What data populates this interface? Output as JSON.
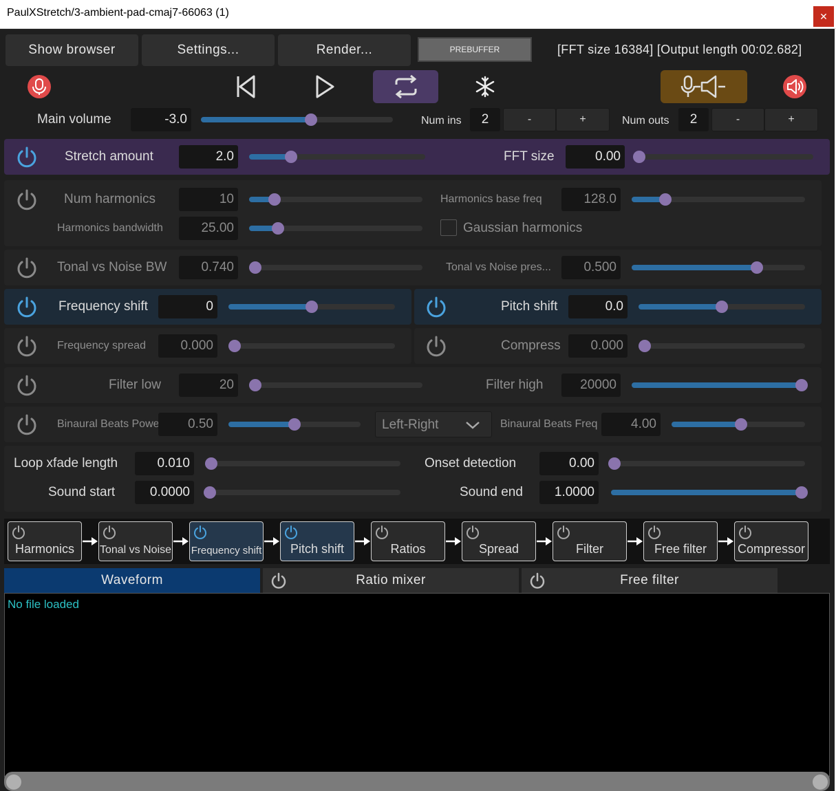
{
  "window": {
    "title": "PaulXStretch/3-ambient-pad-cmaj7-66063 (1)",
    "close_glyph": "✕"
  },
  "toolbar": {
    "show_browser": "Show browser",
    "settings": "Settings...",
    "render": "Render...",
    "prebuffer": "PREBUFFER",
    "info": "[FFT size 16384] [Output length 00:02.682]"
  },
  "transport": {
    "icons": [
      "record-icon",
      "skip-back-icon",
      "play-icon",
      "loop-icon",
      "freeze-icon",
      "mic-speaker-icon",
      "speaker-icon"
    ],
    "loop_active_color": "#4b3a66",
    "monitor_active_color": "#6a4a14"
  },
  "volume": {
    "label": "Main volume",
    "value": "-3.0",
    "level": 0.58,
    "num_ins_label": "Num ins",
    "num_ins": "2",
    "num_outs_label": "Num outs",
    "num_outs": "2",
    "minus": "-",
    "plus": "+"
  },
  "params": {
    "stretch": {
      "label": "Stretch amount",
      "value": "2.0",
      "level": 0.22
    },
    "fft": {
      "label": "FFT size",
      "value": "0.00",
      "level": 0.0
    },
    "num_harmonics": {
      "label": "Num harmonics",
      "value": "10",
      "level": 0.12
    },
    "harm_base": {
      "label": "Harmonics base freq",
      "value": "128.0",
      "level": 0.17
    },
    "harm_bw": {
      "label": "Harmonics bandwidth",
      "value": "25.00",
      "level": 0.14
    },
    "gaussian": {
      "label": "Gaussian harmonics"
    },
    "tonal_bw": {
      "label": "Tonal vs Noise BW",
      "value": "0.740",
      "level": 0.0
    },
    "tonal_pres": {
      "label": "Tonal vs Noise pres...",
      "value": "0.500",
      "level": 0.74
    },
    "freq_shift": {
      "label": "Frequency shift",
      "value": "0",
      "level": 0.5
    },
    "pitch_shift": {
      "label": "Pitch shift",
      "value": "0.0",
      "level": 0.5
    },
    "freq_spread": {
      "label": "Frequency spread",
      "value": "0.000",
      "level": 0.0
    },
    "compress": {
      "label": "Compress",
      "value": "0.000",
      "level": 0.0
    },
    "filter_low": {
      "label": "Filter low",
      "value": "20",
      "level": 0.0
    },
    "filter_high": {
      "label": "Filter high",
      "value": "20000",
      "level": 1.0
    },
    "bb_power": {
      "label": "Binaural Beats Power",
      "value": "0.50",
      "level": 0.5
    },
    "bb_mode": {
      "label": "Left-Right"
    },
    "bb_freq": {
      "label": "Binaural Beats Freq",
      "value": "4.00",
      "level": 0.52
    },
    "loop_xfade": {
      "label": "Loop xfade length",
      "value": "0.010",
      "level": 0.0
    },
    "onset": {
      "label": "Onset detection",
      "value": "0.00",
      "level": 0.0
    },
    "sound_start": {
      "label": "Sound start",
      "value": "0.0000",
      "level": 0.0
    },
    "sound_end": {
      "label": "Sound end",
      "value": "1.0000",
      "level": 1.0
    }
  },
  "chain": [
    {
      "label": "Harmonics",
      "active": false
    },
    {
      "label": "Tonal vs Noise",
      "active": false
    },
    {
      "label": "Frequency shift",
      "active": true
    },
    {
      "label": "Pitch shift",
      "active": true
    },
    {
      "label": "Ratios",
      "active": false
    },
    {
      "label": "Spread",
      "active": false
    },
    {
      "label": "Filter",
      "active": false
    },
    {
      "label": "Free filter",
      "active": false
    },
    {
      "label": "Compressor",
      "active": false
    }
  ],
  "tabs": {
    "waveform": "Waveform",
    "ratio_mixer": "Ratio mixer",
    "free_filter": "Free filter"
  },
  "waveform": {
    "status": "No file loaded"
  },
  "colors": {
    "accent_blue": "#4aa3df",
    "knob": "#8a74ad",
    "fill": "#2d6ea3"
  }
}
